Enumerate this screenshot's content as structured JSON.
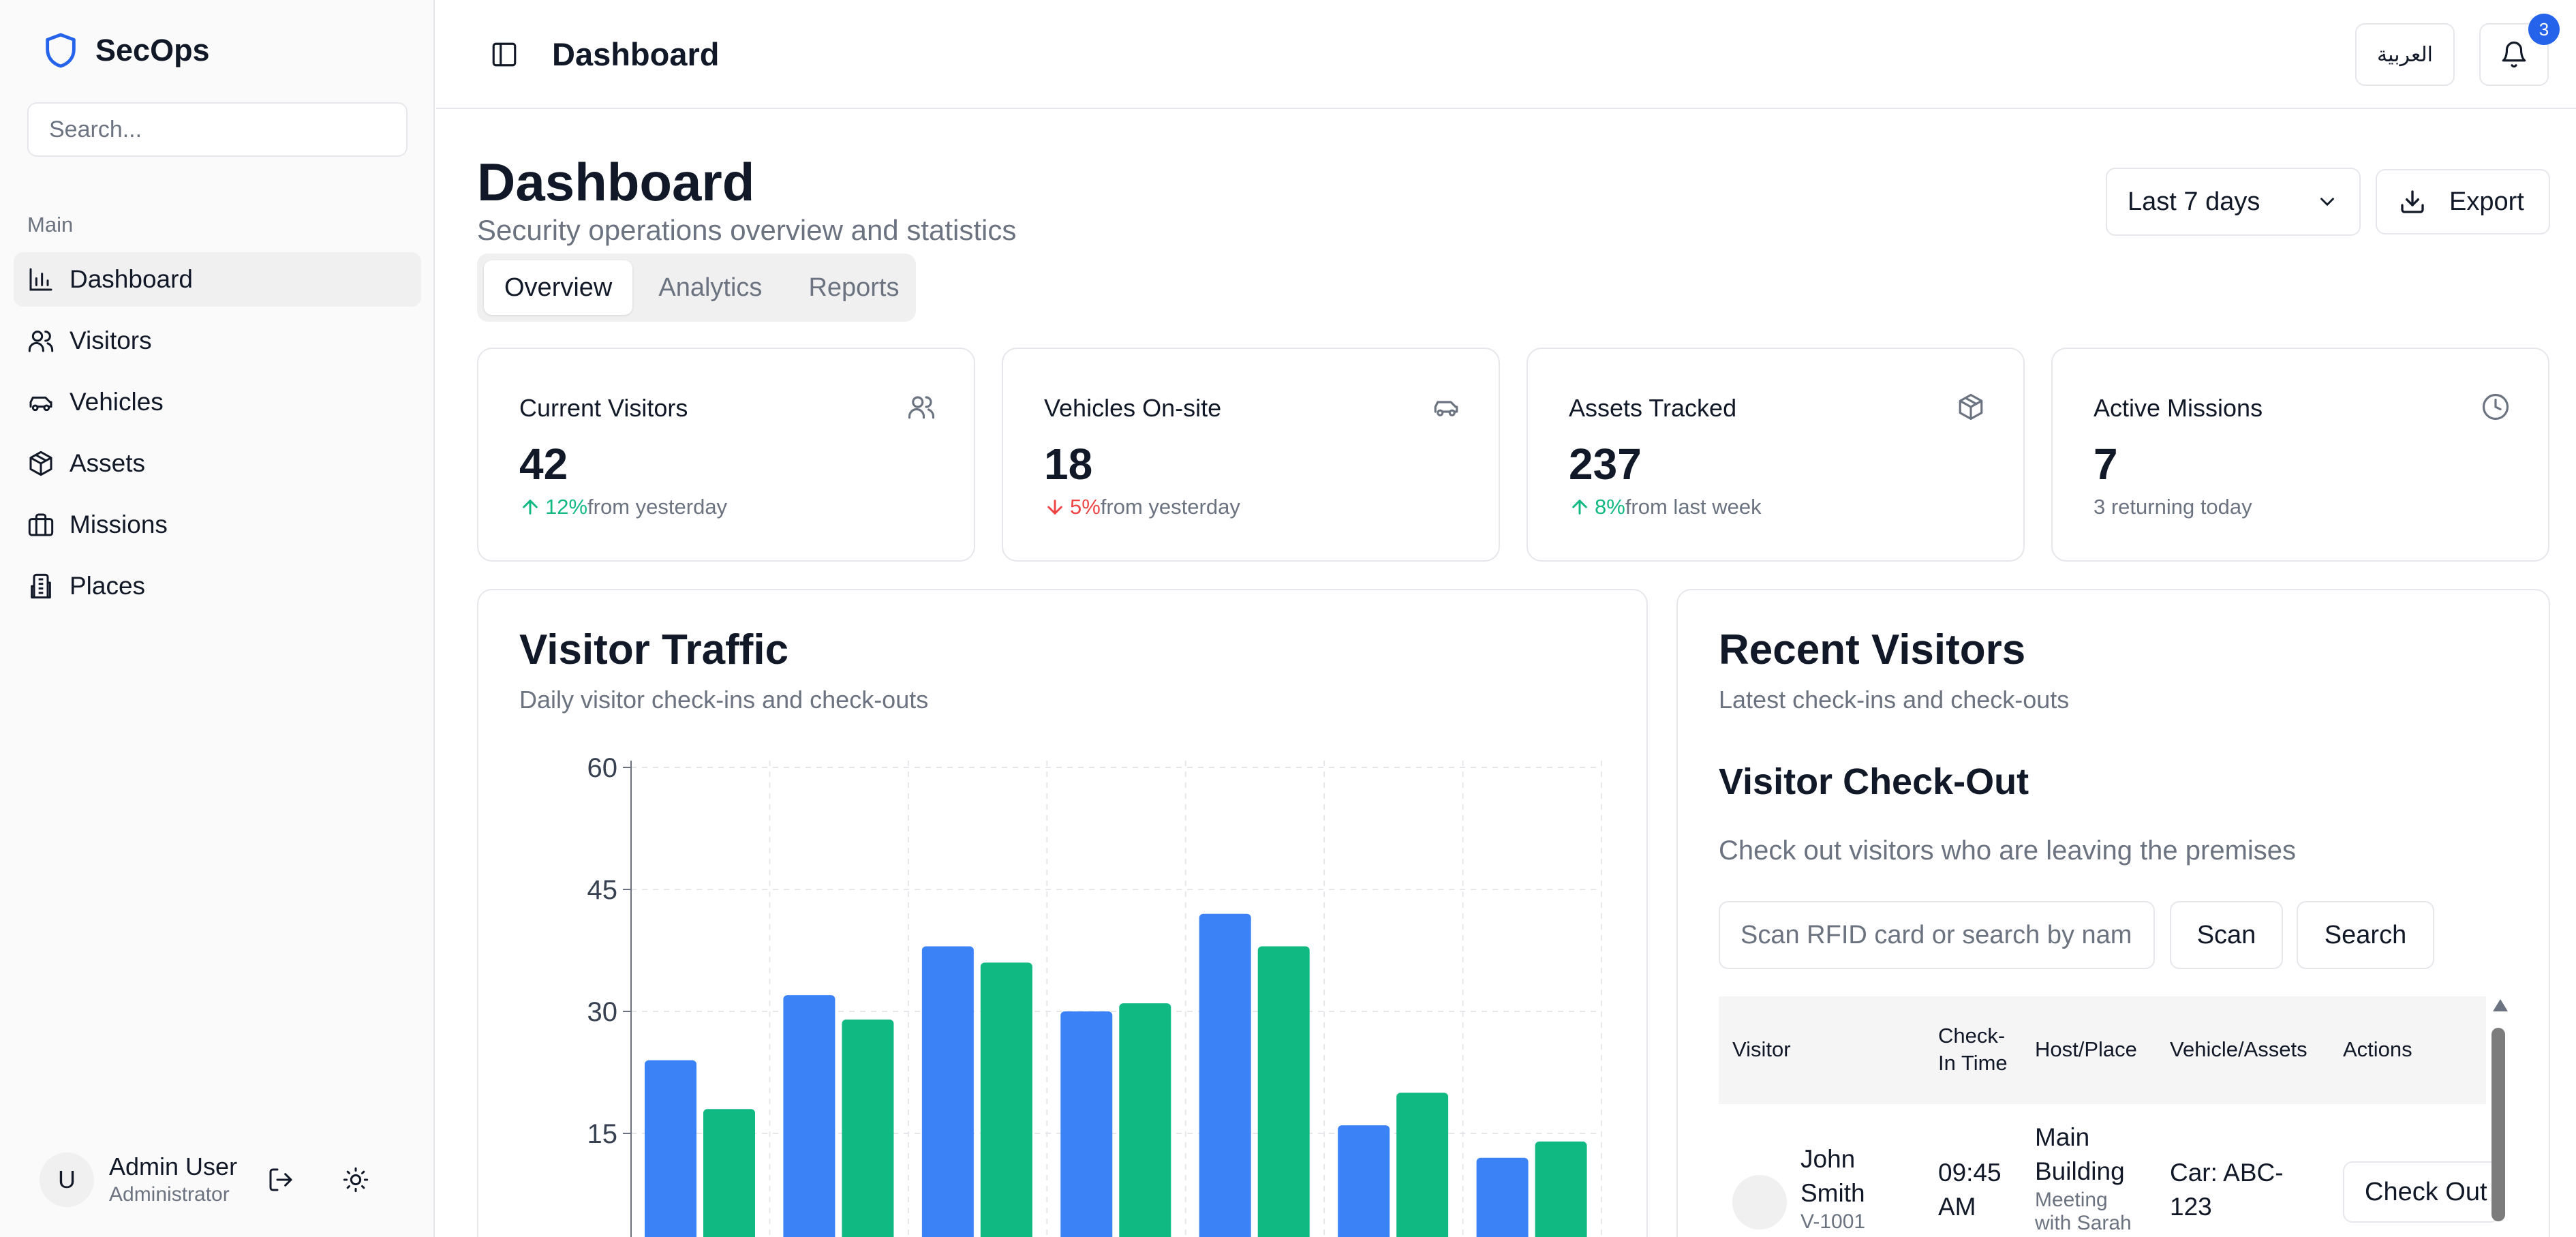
{
  "brand": {
    "name": "SecOps"
  },
  "sidebar": {
    "search_placeholder": "Search...",
    "section_label": "Main",
    "items": [
      {
        "label": "Dashboard",
        "icon": "bar-chart-icon",
        "active": true
      },
      {
        "label": "Visitors",
        "icon": "users-icon"
      },
      {
        "label": "Vehicles",
        "icon": "car-icon"
      },
      {
        "label": "Assets",
        "icon": "package-icon"
      },
      {
        "label": "Missions",
        "icon": "briefcase-icon"
      },
      {
        "label": "Places",
        "icon": "building-icon"
      }
    ],
    "user": {
      "initial": "U",
      "name": "Admin User",
      "role": "Administrator"
    }
  },
  "topbar": {
    "title": "Dashboard",
    "language_button": "العربية",
    "notification_count": "3"
  },
  "page": {
    "title": "Dashboard",
    "subtitle": "Security operations overview and statistics",
    "tabs": [
      {
        "label": "Overview",
        "active": true
      },
      {
        "label": "Analytics"
      },
      {
        "label": "Reports"
      }
    ],
    "range_select": "Last 7 days",
    "export_label": "Export"
  },
  "stats": [
    {
      "label": "Current Visitors",
      "value": "42",
      "trend": "up",
      "pct": "12%",
      "suffix": "from yesterday",
      "icon": "users-icon"
    },
    {
      "label": "Vehicles On-site",
      "value": "18",
      "trend": "down",
      "pct": "5%",
      "suffix": "from yesterday",
      "icon": "car-icon"
    },
    {
      "label": "Assets Tracked",
      "value": "237",
      "trend": "up",
      "pct": "8%",
      "suffix": "from last week",
      "icon": "package-icon"
    },
    {
      "label": "Active Missions",
      "value": "7",
      "trend": "none",
      "pct": "",
      "suffix": "3 returning today",
      "icon": "clock-icon"
    }
  ],
  "traffic": {
    "title": "Visitor Traffic",
    "subtitle": "Daily visitor check-ins and check-outs"
  },
  "chart_data": {
    "type": "bar",
    "title": "Visitor Traffic",
    "subtitle": "Daily visitor check-ins and check-outs",
    "ylim": [
      0,
      60
    ],
    "yticks": [
      15,
      30,
      45,
      60
    ],
    "grid": true,
    "colors": [
      "#3b82f6",
      "#10b981"
    ],
    "series": [
      {
        "values": [
          24,
          32,
          38,
          30,
          42,
          16,
          12
        ]
      },
      {
        "values": [
          18,
          29,
          36,
          31,
          38,
          20,
          14
        ]
      }
    ]
  },
  "recent": {
    "title": "Recent Visitors",
    "subtitle": "Latest check-ins and check-outs",
    "checkout_title": "Visitor Check-Out",
    "checkout_sub": "Check out visitors who are leaving the premises",
    "input_placeholder": "Scan RFID card or search by name, ID, or phone",
    "scan_label": "Scan",
    "search_label": "Search",
    "columns": [
      "Visitor",
      "Check-In Time",
      "Host/Place",
      "Vehicle/Assets",
      "Actions"
    ],
    "rows": [
      {
        "name": "John Smith",
        "id": "V-1001",
        "checkin": "09:45 AM",
        "place": "Main Building",
        "purpose": "Meeting with Sarah",
        "vehicle": "Car: ABC-123",
        "action": "Check Out"
      }
    ]
  }
}
